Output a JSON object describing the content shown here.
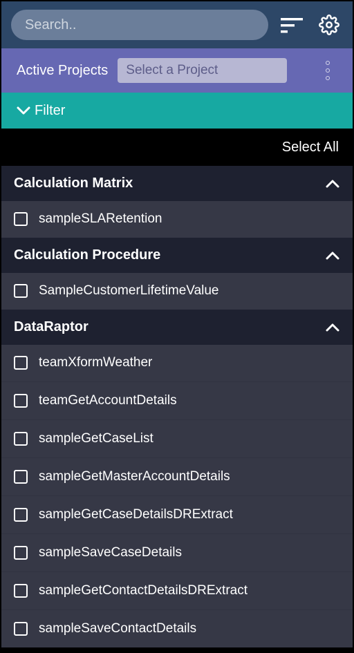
{
  "search": {
    "placeholder": "Search.."
  },
  "projects": {
    "label": "Active Projects",
    "select_placeholder": "Select a Project"
  },
  "filter": {
    "label": "Filter"
  },
  "select_all": "Select All",
  "sections": [
    {
      "title": "Calculation Matrix",
      "items": [
        "sampleSLARetention"
      ]
    },
    {
      "title": "Calculation Procedure",
      "items": [
        "SampleCustomerLifetimeValue"
      ]
    },
    {
      "title": "DataRaptor",
      "items": [
        "teamXformWeather",
        "teamGetAccountDetails",
        "sampleGetCaseList",
        "sampleGetMasterAccountDetails",
        "sampleGetCaseDetailsDRExtract",
        "sampleSaveCaseDetails",
        "sampleGetContactDetailsDRExtract",
        "sampleSaveContactDetails"
      ]
    }
  ]
}
